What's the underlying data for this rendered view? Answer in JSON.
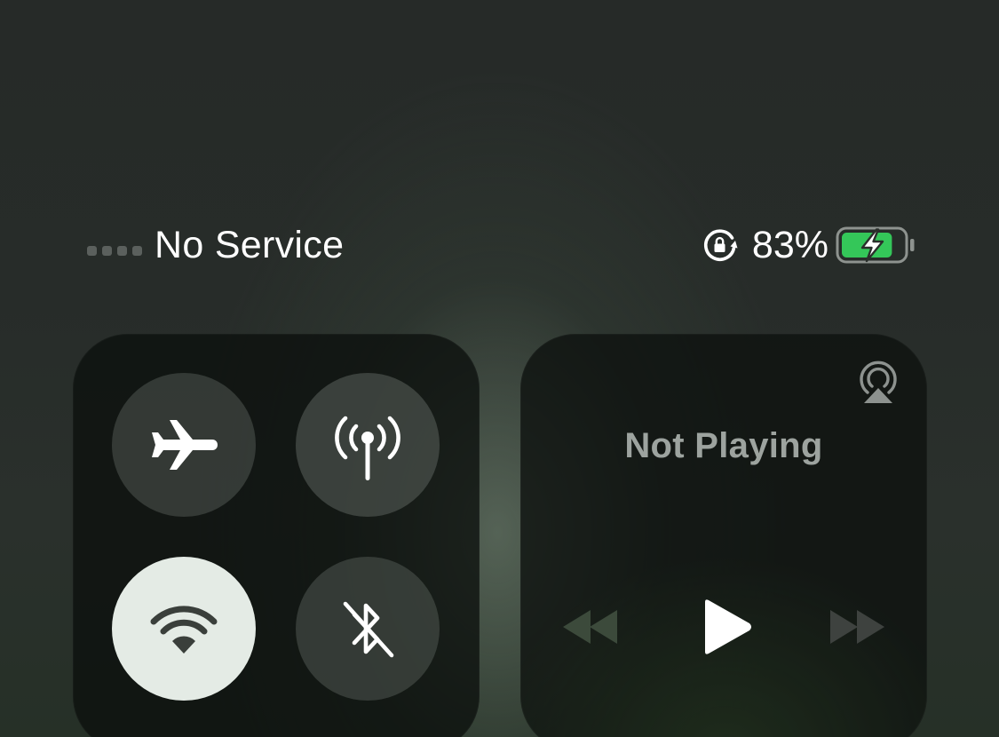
{
  "status_bar": {
    "carrier": "No Service",
    "signal_bars_filled": 0,
    "signal_bars_total": 4,
    "battery_percent": "83%",
    "battery_level": 0.83,
    "charging": true,
    "icons": [
      "lock-rotation-icon",
      "battery-charging-icon"
    ]
  },
  "connectivity": {
    "airplane": {
      "icon": "airplane-icon",
      "on": false
    },
    "cellular": {
      "icon": "cellular-antenna-icon",
      "on": false
    },
    "wifi": {
      "icon": "wifi-icon",
      "on": true
    },
    "bluetooth": {
      "icon": "bluetooth-off-icon",
      "on": false
    }
  },
  "media": {
    "title": "Not Playing",
    "airplay_icon": "airplay-icon",
    "controls": [
      "rewind-icon",
      "play-icon",
      "fast-forward-icon"
    ]
  },
  "colors": {
    "battery_fill": "#34c759",
    "wifi_active_bg": "#e4ebe5",
    "text": "#ffffff",
    "muted_text": "#9da39f"
  }
}
